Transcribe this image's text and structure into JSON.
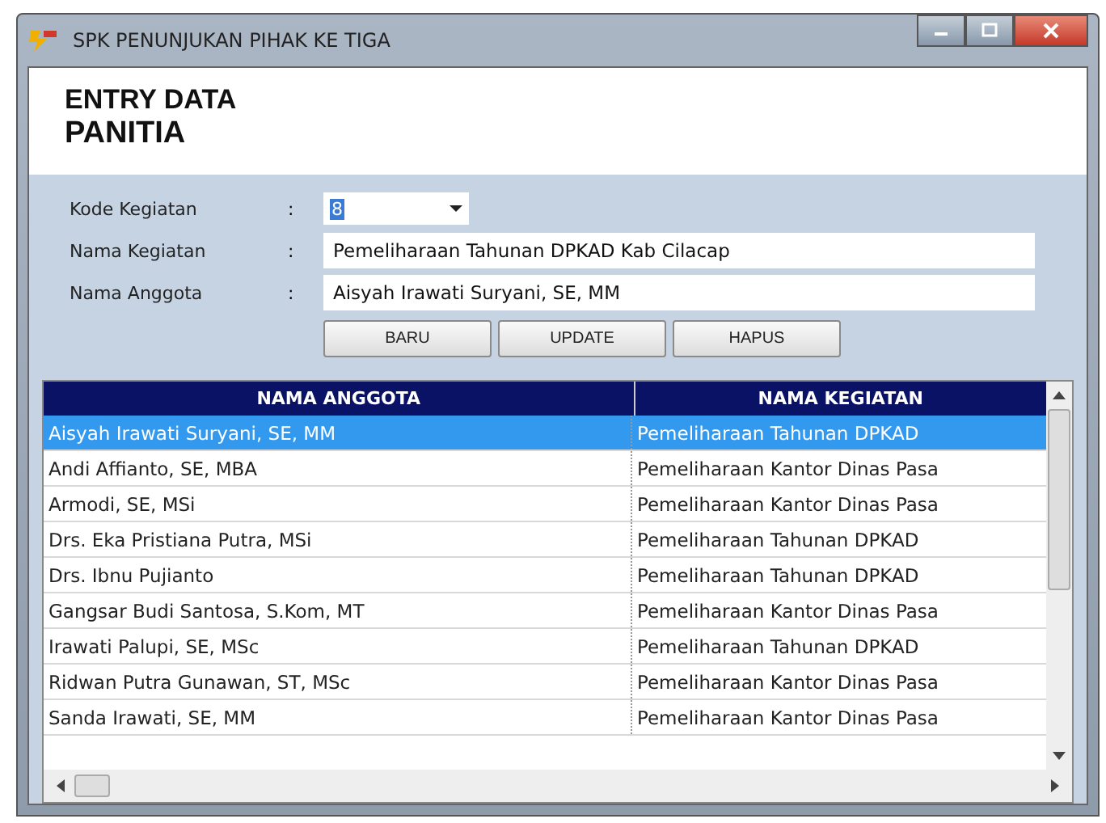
{
  "window": {
    "title": "SPK PENUNJUKAN PIHAK KE TIGA"
  },
  "header": {
    "line_1": "ENTRY DATA",
    "line_2": "PANITIA"
  },
  "form": [
    {
      "kind": "dropdown",
      "label": "Kode Kegiatan",
      "separator": ":",
      "value": "8"
    },
    {
      "kind": "text",
      "label": "Nama Kegiatan",
      "separator": ":",
      "value": "Pemeliharaan Tahunan DPKAD Kab Cilacap"
    },
    {
      "kind": "text",
      "label": "Nama Anggota",
      "separator": ":",
      "value": "Aisyah Irawati Suryani, SE, MM"
    }
  ],
  "buttons": [
    "BARU",
    "UPDATE",
    "HAPUS"
  ],
  "table": {
    "columns": [
      "NAMA ANGGOTA",
      "NAMA KEGIATAN"
    ],
    "rows": [
      {
        "cells": [
          "Aisyah Irawati Suryani, SE, MM",
          "Pemeliharaan Tahunan DPKAD"
        ],
        "selected": true
      },
      {
        "cells": [
          "Andi Affianto, SE, MBA",
          "Pemeliharaan Kantor Dinas Pasa"
        ],
        "selected": false
      },
      {
        "cells": [
          "Armodi, SE, MSi",
          "Pemeliharaan Kantor Dinas Pasa"
        ],
        "selected": false
      },
      {
        "cells": [
          "Drs. Eka Pristiana Putra, MSi",
          "Pemeliharaan Tahunan DPKAD"
        ],
        "selected": false
      },
      {
        "cells": [
          "Drs. Ibnu Pujianto",
          "Pemeliharaan Tahunan DPKAD"
        ],
        "selected": false
      },
      {
        "cells": [
          "Gangsar Budi Santosa, S.Kom, MT",
          "Pemeliharaan Kantor Dinas Pasa"
        ],
        "selected": false
      },
      {
        "cells": [
          "Irawati Palupi, SE, MSc",
          "Pemeliharaan Tahunan DPKAD"
        ],
        "selected": false
      },
      {
        "cells": [
          "Ridwan Putra Gunawan, ST, MSc",
          "Pemeliharaan Kantor Dinas Pasa"
        ],
        "selected": false
      },
      {
        "cells": [
          "Sanda Irawati, SE, MM",
          "Pemeliharaan Kantor Dinas Pasa"
        ],
        "selected": false
      }
    ]
  }
}
